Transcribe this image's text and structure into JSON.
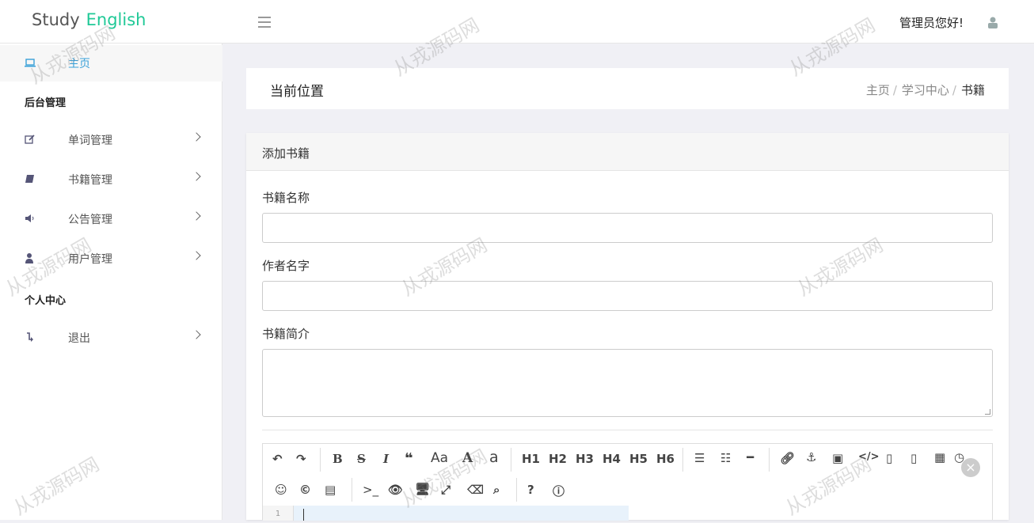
{
  "header": {
    "logo_word1": "Study",
    "logo_word2": "English",
    "greeting": "管理员您好!"
  },
  "sidebar": {
    "home": "主页",
    "section_admin": "后台管理",
    "items": [
      {
        "label": "单词管理",
        "icon": "edit-icon"
      },
      {
        "label": "书籍管理",
        "icon": "book-icon"
      },
      {
        "label": "公告管理",
        "icon": "volume-icon"
      },
      {
        "label": "用户管理",
        "icon": "user-icon"
      }
    ],
    "section_personal": "个人中心",
    "logout": "退出"
  },
  "breadcrumb": {
    "title": "当前位置",
    "items": [
      "主页",
      "学习中心",
      "书籍"
    ]
  },
  "form": {
    "panel_title": "添加书籍",
    "name_label": "书籍名称",
    "author_label": "作者名字",
    "intro_label": "书籍简介"
  },
  "editor": {
    "tools": [
      "undo",
      "redo",
      "B",
      "S",
      "I",
      "quote",
      "Aa",
      "A",
      "a",
      "H1",
      "H2",
      "H3",
      "H4",
      "H5",
      "H6",
      "unordered-list",
      "ordered-list",
      "hr",
      "link",
      "anchor",
      "image",
      "code",
      "code-block",
      "preformatted",
      "table",
      "datetime",
      "emoji",
      "html-entities",
      "pagebreak",
      "terminal",
      "watch",
      "preview",
      "fullscreen",
      "clear",
      "search",
      "help",
      "info"
    ],
    "labels": {
      "bold": "B",
      "strike": "S",
      "italic": "I",
      "aa": "Aa",
      "A": "A",
      "a": "a",
      "h1": "H1",
      "h2": "H2",
      "h3": "H3",
      "h4": "H4",
      "h5": "H5",
      "h6": "H6"
    },
    "line_number": "1"
  },
  "watermark": "从戎源码网"
}
